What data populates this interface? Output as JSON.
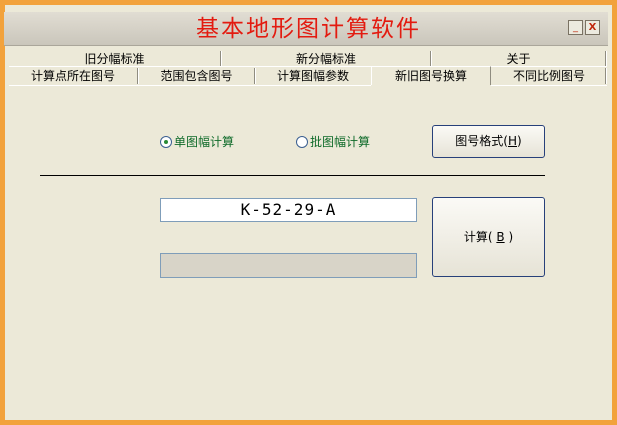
{
  "window": {
    "title": "基本地形图计算软件",
    "minimize_glyph": "_",
    "close_glyph": "X"
  },
  "tabs": {
    "row1": [
      {
        "label": "旧分幅标准"
      },
      {
        "label": "新分幅标准"
      },
      {
        "label": "关于"
      }
    ],
    "row2": [
      {
        "label": "计算点所在图号"
      },
      {
        "label": "范围包含图号"
      },
      {
        "label": "计算图幅参数"
      },
      {
        "label": "新旧图号换算",
        "active": true
      },
      {
        "label": "不同比例图号"
      }
    ]
  },
  "options": {
    "single_label": "单图幅计算",
    "batch_label": "批图幅计算",
    "selected": "single"
  },
  "buttons": {
    "format_label": "图号格式",
    "format_hotkey": "H",
    "calc_label": "计算",
    "calc_hotkey": "B"
  },
  "fields": {
    "input_value": "K-52-29-A",
    "output_value": ""
  },
  "colors": {
    "window_frame": "#f2a23c",
    "title_text": "#e31b10",
    "radio_text": "#0f6b2a",
    "panel_bg": "#ece9d8"
  }
}
